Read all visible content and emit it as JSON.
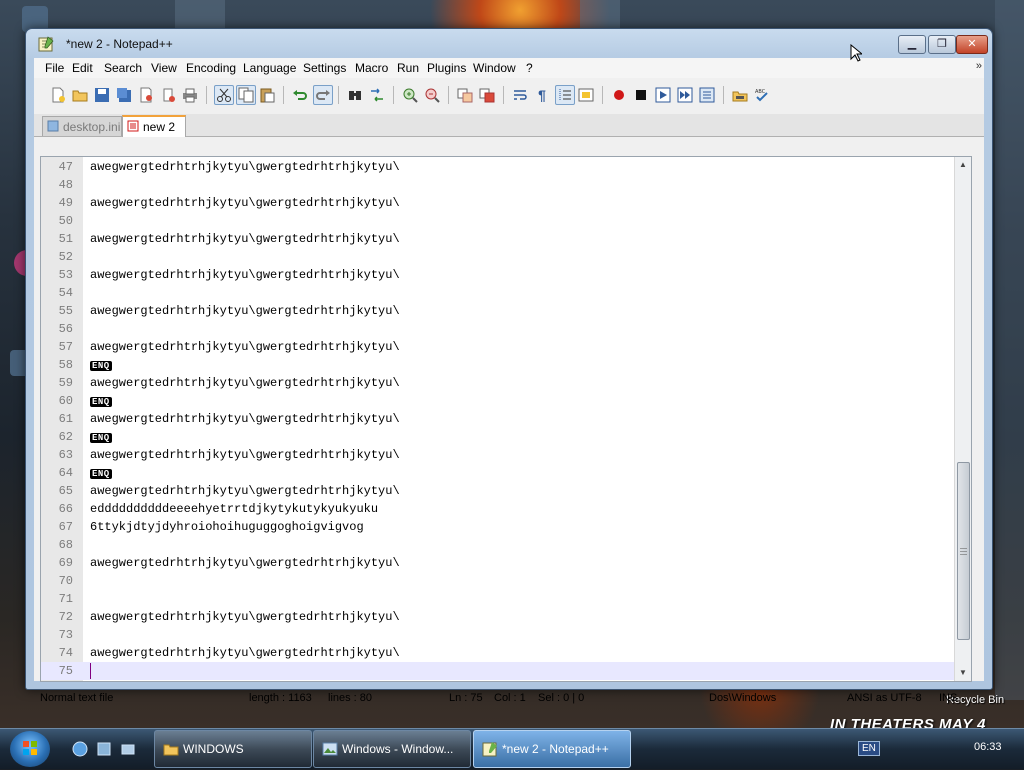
{
  "window": {
    "title": "*new  2 - Notepad++"
  },
  "menu": [
    {
      "label": "File"
    },
    {
      "label": "Edit"
    },
    {
      "label": "Search"
    },
    {
      "label": "View"
    },
    {
      "label": "Encoding"
    },
    {
      "label": "Language"
    },
    {
      "label": "Settings"
    },
    {
      "label": "Macro"
    },
    {
      "label": "Run"
    },
    {
      "label": "Plugins"
    },
    {
      "label": "Window"
    },
    {
      "label": "?"
    }
  ],
  "menu_overflow": "»",
  "tabs": [
    {
      "label": "desktop.ini",
      "active": false
    },
    {
      "label": "new  2",
      "active": true
    }
  ],
  "editor": {
    "current_line": 75,
    "lines": [
      {
        "n": "47",
        "text": "awegwergtedrhtrhjkytyu\\gwergtedrhtrhjkytyu\\"
      },
      {
        "n": "48",
        "text": ""
      },
      {
        "n": "49",
        "text": "awegwergtedrhtrhjkytyu\\gwergtedrhtrhjkytyu\\"
      },
      {
        "n": "50",
        "text": ""
      },
      {
        "n": "51",
        "text": "awegwergtedrhtrhjkytyu\\gwergtedrhtrhjkytyu\\"
      },
      {
        "n": "52",
        "text": ""
      },
      {
        "n": "53",
        "text": "awegwergtedrhtrhjkytyu\\gwergtedrhtrhjkytyu\\"
      },
      {
        "n": "54",
        "text": ""
      },
      {
        "n": "55",
        "text": "awegwergtedrhtrhjkytyu\\gwergtedrhtrhjkytyu\\"
      },
      {
        "n": "56",
        "text": ""
      },
      {
        "n": "57",
        "text": "awegwergtedrhtrhjkytyu\\gwergtedrhtrhjkytyu\\"
      },
      {
        "n": "58",
        "text": "",
        "ctrl": "ENQ"
      },
      {
        "n": "59",
        "text": "awegwergtedrhtrhjkytyu\\gwergtedrhtrhjkytyu\\"
      },
      {
        "n": "60",
        "text": "",
        "ctrl": "ENQ"
      },
      {
        "n": "61",
        "text": "awegwergtedrhtrhjkytyu\\gwergtedrhtrhjkytyu\\"
      },
      {
        "n": "62",
        "text": "",
        "ctrl": "ENQ"
      },
      {
        "n": "63",
        "text": "awegwergtedrhtrhjkytyu\\gwergtedrhtrhjkytyu\\"
      },
      {
        "n": "64",
        "text": "",
        "ctrl": "ENQ"
      },
      {
        "n": "65",
        "text": "awegwergtedrhtrhjkytyu\\gwergtedrhtrhjkytyu\\"
      },
      {
        "n": "66",
        "text": "eddddddddddeeeehyetrrtdjkytykutykyukyuku"
      },
      {
        "n": "67",
        "text": "6ttykjdtyjdyhroiohoihuguggoghoigvigvog"
      },
      {
        "n": "68",
        "text": ""
      },
      {
        "n": "69",
        "text": "awegwergtedrhtrhjkytyu\\gwergtedrhtrhjkytyu\\"
      },
      {
        "n": "70",
        "text": ""
      },
      {
        "n": "71",
        "text": ""
      },
      {
        "n": "72",
        "text": "awegwergtedrhtrhjkytyu\\gwergtedrhtrhjkytyu\\"
      },
      {
        "n": "73",
        "text": ""
      },
      {
        "n": "74",
        "text": "awegwergtedrhtrhjkytyu\\gwergtedrhtrhjkytyu\\"
      },
      {
        "n": "75",
        "text": ""
      }
    ]
  },
  "status": {
    "file_type": "Normal text file",
    "length": "length : 1163",
    "lines": "lines : 80",
    "ln": "Ln : 75",
    "col": "Col : 1",
    "sel": "Sel : 0 | 0",
    "eol": "Dos\\Windows",
    "encoding": "ANSI as UTF-8",
    "mode": "INS"
  },
  "taskbar": {
    "items": [
      {
        "label": "WINDOWS",
        "active": false
      },
      {
        "label": "Windows - Window...",
        "active": false
      },
      {
        "label": "*new  2 - Notepad++",
        "active": true
      }
    ],
    "lang": "EN",
    "clock": "06:33"
  },
  "desktop": {
    "recycle_bin": "Recycle Bin",
    "banner": "IN THEATERS MAY 4"
  },
  "colors": {
    "tab_accent": "#f2a23b",
    "current_line": "#e8e8ff",
    "caret": "#800080"
  }
}
